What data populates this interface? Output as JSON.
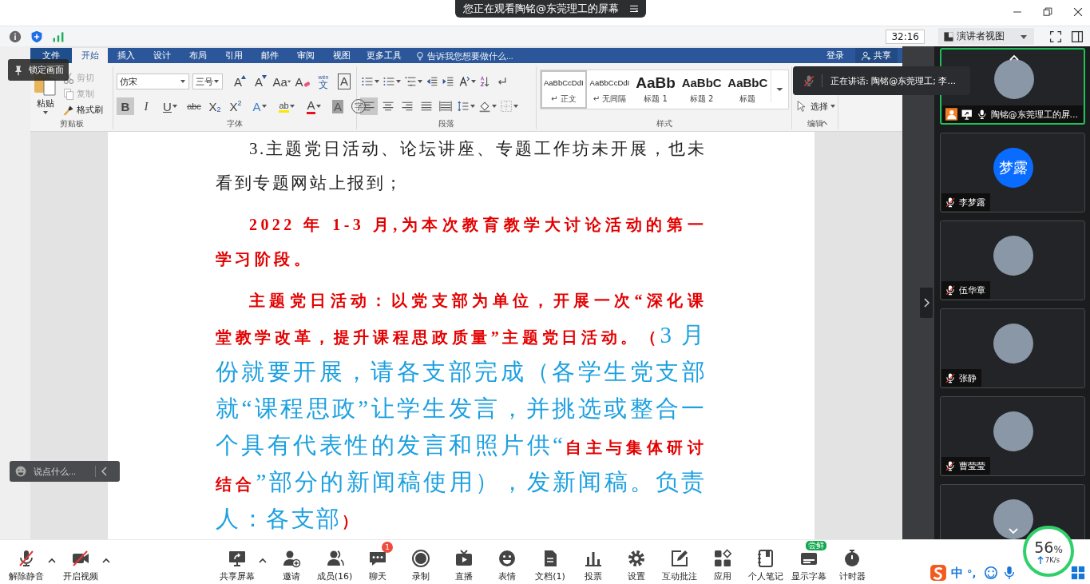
{
  "banner": {
    "text": "您正在观看陶铭@东莞理工的屏幕"
  },
  "toolbar": {
    "timer": "32:16",
    "view_mode": "演讲者视图"
  },
  "word": {
    "tabs": [
      {
        "label": "文件",
        "kind": "file",
        "selected": false
      },
      {
        "label": "开始",
        "kind": "tab",
        "selected": true
      },
      {
        "label": "插入",
        "kind": "tab",
        "selected": false
      },
      {
        "label": "设计",
        "kind": "tab",
        "selected": false
      },
      {
        "label": "布局",
        "kind": "tab",
        "selected": false
      },
      {
        "label": "引用",
        "kind": "tab",
        "selected": false
      },
      {
        "label": "邮件",
        "kind": "tab",
        "selected": false
      },
      {
        "label": "审阅",
        "kind": "tab",
        "selected": false
      },
      {
        "label": "视图",
        "kind": "tab",
        "selected": false
      },
      {
        "label": "更多工具",
        "kind": "tab",
        "selected": false
      }
    ],
    "tell_me": {
      "placeholder": "告诉我您想要做什么..."
    },
    "sign_in": "登录",
    "share": "共享",
    "clipboard": {
      "paste": "粘贴",
      "label": "剪贴板",
      "items": [
        {
          "label": "剪切",
          "kind": "cut",
          "disabled": true
        },
        {
          "label": "复制",
          "kind": "copy",
          "disabled": true
        },
        {
          "label": "格式刷",
          "kind": "painter",
          "disabled": false
        }
      ]
    },
    "font": {
      "name": "仿宋",
      "size": "三号",
      "label": "字体",
      "row1": [
        {
          "kind": "grow",
          "label": "A"
        },
        {
          "kind": "shrink",
          "label": "A"
        },
        {
          "kind": "case",
          "label": "Aa"
        },
        {
          "kind": "clear",
          "label": "A"
        },
        {
          "kind": "phonetic",
          "label": "文",
          "ruby": "wén"
        },
        {
          "kind": "border",
          "label": "A"
        }
      ],
      "row2": [
        {
          "kind": "bold",
          "label": "B",
          "on": true
        },
        {
          "kind": "italic",
          "label": "I",
          "on": false
        },
        {
          "kind": "underline",
          "label": "U",
          "on": false
        },
        {
          "kind": "strike",
          "label": "abc",
          "on": false
        },
        {
          "kind": "sub",
          "label": "X",
          "script": "2",
          "on": false
        },
        {
          "kind": "sup",
          "label": "X",
          "script": "2",
          "on": false
        },
        {
          "kind": "effect",
          "label": "A",
          "on": false
        },
        {
          "kind": "highlight",
          "label": "ab",
          "on": false
        },
        {
          "kind": "color",
          "label": "A",
          "on": false
        },
        {
          "kind": "shade",
          "label": "A",
          "on": false
        },
        {
          "kind": "enclose",
          "label": "字",
          "on": false
        }
      ]
    },
    "paragraph": {
      "label": "段落",
      "align": [
        {
          "selected": true
        },
        {
          "selected": false
        },
        {
          "selected": false
        },
        {
          "selected": false
        },
        {
          "selected": false
        }
      ]
    },
    "styles": {
      "label": "样式",
      "items": [
        {
          "preview": "AaBbCcDdI",
          "name": "正文",
          "para_mark": "↵",
          "kind": "normal",
          "selected": true
        },
        {
          "preview": "AaBbCcDdI",
          "name": "无间隔",
          "para_mark": "↵",
          "kind": "normal",
          "selected": false
        },
        {
          "preview": "AaBb",
          "name": "标题 1",
          "kind": "heading1",
          "selected": false
        },
        {
          "preview": "AaBbC",
          "name": "标题 2",
          "kind": "heading2",
          "selected": false
        },
        {
          "preview": "AaBbC",
          "name": "标题",
          "kind": "heading2",
          "selected": false
        }
      ]
    },
    "editing": {
      "select": "选择",
      "label": "编辑"
    },
    "document": {
      "paragraphs": [
        {
          "runs": [
            {
              "kind": "body",
              "text": "3.主题党日活动、论坛讲座、专题工作坊未开展，也未看到专题网站上报到；"
            }
          ]
        },
        {
          "runs": [
            {
              "kind": "red",
              "text": "2022 年 1-3 月,为本次教育教学大讨论活动的第一学习阶段。"
            }
          ]
        },
        {
          "runs": [
            {
              "kind": "red",
              "text": "主题党日活动：以党支部为单位，开展一次“深化课堂教学改革，提升课程思政质量”主题党日活动。（"
            },
            {
              "kind": "cyan",
              "text": "3 月份就要开展，请各支部完成（各学生党支部就“课程思政”让学生发言，并挑选或整合一个具有代表性的发言和照片供“"
            },
            {
              "kind": "red",
              "text": "自主与集体研讨结合"
            },
            {
              "kind": "cyan",
              "text": "”部分的新闻稿使用），发新闻稿。负责人：各支部"
            },
            {
              "kind": "red",
              "text": "）"
            }
          ]
        }
      ]
    }
  },
  "overlays": {
    "lock": "锁定画面",
    "chat": {
      "placeholder": "说点什么..."
    },
    "speaking": "正在讲话: 陶铭@东莞理工; 李..."
  },
  "participants": [
    {
      "name": "陶铭@东莞理工的屏...",
      "kind": "photo",
      "muted": false,
      "active": true,
      "host": true
    },
    {
      "name": "李梦露",
      "kind": "initials",
      "avatar_text": "梦露",
      "muted": true,
      "active": false,
      "host": false
    },
    {
      "name": "伍华章",
      "kind": "photo",
      "muted": true,
      "active": false,
      "host": false
    },
    {
      "name": "张静",
      "kind": "photo",
      "muted": true,
      "active": false,
      "host": false
    },
    {
      "name": "曹莹莹",
      "kind": "photo",
      "muted": true,
      "active": false,
      "host": false
    },
    {
      "kind": "photo",
      "active": false,
      "host": false
    }
  ],
  "bottom": {
    "left": [
      {
        "label": "解除静音",
        "kind": "mic-off"
      },
      {
        "kind": "caret"
      },
      {
        "label": "开启视频",
        "kind": "video-off"
      },
      {
        "kind": "caret"
      }
    ],
    "center": [
      {
        "label": "共享屏幕",
        "kind": "share"
      },
      {
        "kind": "caret"
      },
      {
        "label": "邀请",
        "kind": "invite"
      },
      {
        "label": "成员(16)",
        "kind": "members"
      },
      {
        "label": "聊天",
        "kind": "chat",
        "badge": "1"
      },
      {
        "label": "录制",
        "kind": "record"
      },
      {
        "label": "直播",
        "kind": "live"
      },
      {
        "label": "表情",
        "kind": "emoji"
      },
      {
        "label": "文档(1)",
        "kind": "doc"
      },
      {
        "label": "投票",
        "kind": "vote"
      },
      {
        "label": "设置",
        "kind": "settings"
      },
      {
        "label": "互动批注",
        "kind": "annotate"
      },
      {
        "label": "应用",
        "kind": "apps"
      },
      {
        "label": "个人笔记",
        "kind": "notes"
      },
      {
        "label": "显示字幕",
        "kind": "captions",
        "tag": "尝鲜"
      },
      {
        "label": "计时器",
        "kind": "timer"
      }
    ]
  },
  "ime": {
    "mode": "中",
    "punct": "°,"
  },
  "network": {
    "value": "56",
    "unit": "%",
    "speed": "7K/s"
  }
}
